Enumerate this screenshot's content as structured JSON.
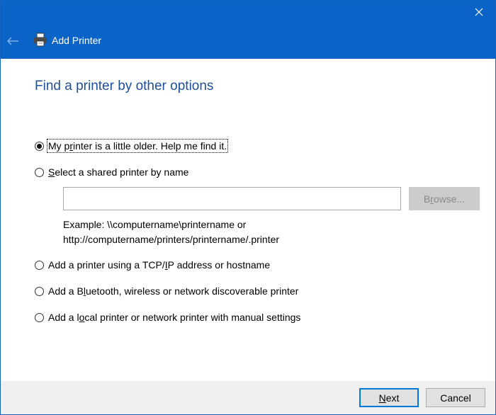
{
  "window": {
    "header_title": "Add Printer",
    "colors": {
      "accent": "#0a64c8",
      "title_text": "#1d4f9c"
    }
  },
  "page": {
    "title": "Find a printer by other options"
  },
  "options": [
    {
      "pre": "My p",
      "key": "r",
      "post": "inter is a little older. Help me find it.",
      "checked": true
    },
    {
      "pre": "",
      "key": "S",
      "post": "elect a shared printer by name",
      "checked": false
    },
    {
      "pre": "Add a printer using a TCP/",
      "key": "I",
      "post": "P address or hostname",
      "checked": false
    },
    {
      "pre": "Add a B",
      "key": "l",
      "post": "uetooth, wireless or network discoverable printer",
      "checked": false
    },
    {
      "pre": "Add a l",
      "key": "o",
      "post": "cal printer or network printer with manual settings",
      "checked": false
    }
  ],
  "shared_name": {
    "value": "",
    "browse_pre": "B",
    "browse_key": "r",
    "browse_post": "owse...",
    "example_line1": "Example: \\\\computername\\printername or",
    "example_line2": "http://computername/printers/printername/.printer"
  },
  "footer": {
    "next_key": "N",
    "next_post": "ext",
    "cancel_label": "Cancel"
  },
  "icons": [
    "close-icon",
    "back-arrow-icon",
    "printer-icon"
  ]
}
